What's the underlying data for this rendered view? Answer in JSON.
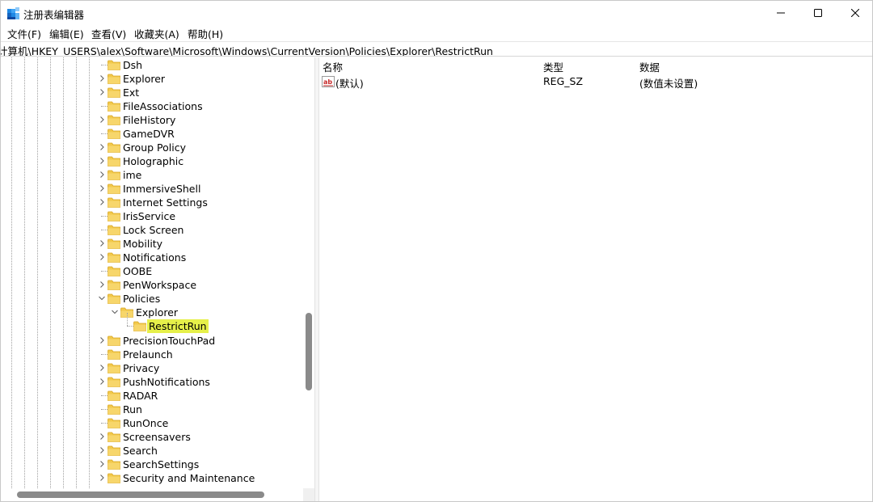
{
  "window": {
    "title": "注册表编辑器",
    "controls": {
      "minimize": "minimize-icon",
      "maximize": "maximize-icon",
      "close": "close-icon"
    },
    "accent": "#2b7fd6"
  },
  "menu": {
    "items": [
      {
        "label": "文件(F)"
      },
      {
        "label": "编辑(E)"
      },
      {
        "label": "查看(V)"
      },
      {
        "label": "收藏夹(A)"
      },
      {
        "label": "帮助(H)"
      }
    ]
  },
  "address": {
    "path": "计算机\\HKEY_USERS\\alex\\Software\\Microsoft\\Windows\\CurrentVersion\\Policies\\Explorer\\RestrictRun"
  },
  "tree": {
    "selection_color": "#e6f04a",
    "folder_color": "#f2c94c",
    "items": [
      {
        "label": "Dsh",
        "expander": false,
        "level": 0
      },
      {
        "label": "Explorer",
        "expander": true,
        "level": 0
      },
      {
        "label": "Ext",
        "expander": true,
        "level": 0
      },
      {
        "label": "FileAssociations",
        "expander": false,
        "level": 0
      },
      {
        "label": "FileHistory",
        "expander": true,
        "level": 0
      },
      {
        "label": "GameDVR",
        "expander": false,
        "level": 0
      },
      {
        "label": "Group Policy",
        "expander": true,
        "level": 0
      },
      {
        "label": "Holographic",
        "expander": true,
        "level": 0
      },
      {
        "label": "ime",
        "expander": true,
        "level": 0
      },
      {
        "label": "ImmersiveShell",
        "expander": true,
        "level": 0
      },
      {
        "label": "Internet Settings",
        "expander": true,
        "level": 0
      },
      {
        "label": "IrisService",
        "expander": false,
        "level": 0
      },
      {
        "label": "Lock Screen",
        "expander": false,
        "level": 0
      },
      {
        "label": "Mobility",
        "expander": true,
        "level": 0
      },
      {
        "label": "Notifications",
        "expander": true,
        "level": 0
      },
      {
        "label": "OOBE",
        "expander": false,
        "level": 0
      },
      {
        "label": "PenWorkspace",
        "expander": true,
        "level": 0
      },
      {
        "label": "Policies",
        "expander": "open",
        "level": 0
      },
      {
        "label": "Explorer",
        "expander": "open",
        "level": 1
      },
      {
        "label": "RestrictRun",
        "expander": false,
        "level": 2,
        "selected": true
      },
      {
        "label": "PrecisionTouchPad",
        "expander": true,
        "level": 0
      },
      {
        "label": "Prelaunch",
        "expander": false,
        "level": 0
      },
      {
        "label": "Privacy",
        "expander": true,
        "level": 0
      },
      {
        "label": "PushNotifications",
        "expander": true,
        "level": 0
      },
      {
        "label": "RADAR",
        "expander": false,
        "level": 0
      },
      {
        "label": "Run",
        "expander": false,
        "level": 0
      },
      {
        "label": "RunOnce",
        "expander": false,
        "level": 0
      },
      {
        "label": "Screensavers",
        "expander": true,
        "level": 0
      },
      {
        "label": "Search",
        "expander": true,
        "level": 0
      },
      {
        "label": "SearchSettings",
        "expander": true,
        "level": 0
      },
      {
        "label": "Security and Maintenance",
        "expander": true,
        "level": 0
      }
    ]
  },
  "list": {
    "columns": {
      "name": "名称",
      "type": "类型",
      "data": "数据"
    },
    "rows": [
      {
        "icon": "string-value-icon",
        "name": "(默认)",
        "type": "REG_SZ",
        "data": "(数值未设置)"
      }
    ]
  }
}
